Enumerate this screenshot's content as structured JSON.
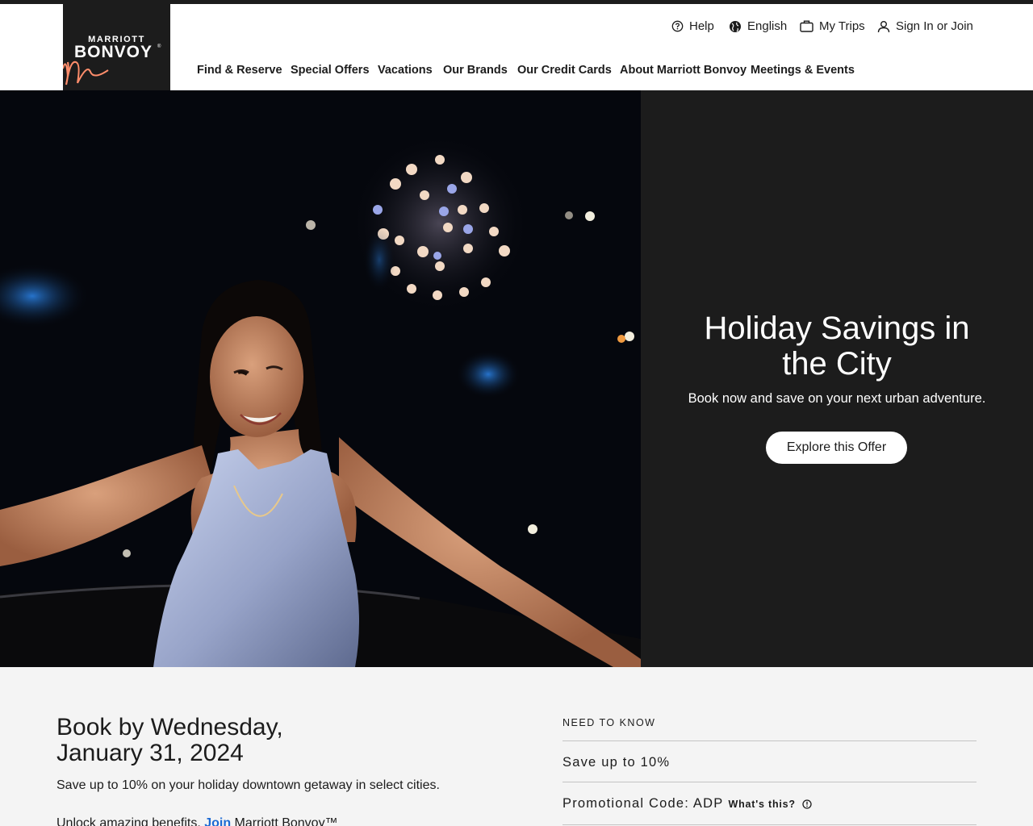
{
  "brand": {
    "logo_line1": "MARRIOTT",
    "logo_line2": "BONVOY",
    "logo_tm": "®",
    "logo_bg": "#1c1c1c",
    "accent": "#ff8d6b"
  },
  "utility_nav": {
    "help": {
      "label": "Help",
      "icon": "help-circle-icon"
    },
    "language": {
      "label": "English",
      "icon": "globe-icon"
    },
    "trips": {
      "label": "My Trips",
      "icon": "suitcase-icon"
    },
    "account": {
      "label": "Sign In or Join",
      "icon": "user-icon"
    }
  },
  "main_nav": [
    "Find & Reserve",
    "Special Offers",
    "Vacations",
    "Our Brands",
    "Our Credit Cards",
    "About Marriott Bonvoy",
    "Meetings & Events"
  ],
  "hero": {
    "title_line1": "Holiday Savings in",
    "title_line2": "the City",
    "subtitle": "Book now and save on your next urban adventure.",
    "cta": "Explore this Offer",
    "panel_bg": "#1c1c1c"
  },
  "offer": {
    "title_line1": "Book by Wednesday,",
    "title_line2": "January 31, 2024",
    "description": "Save up to 10% on your holiday downtown getaway in select cities.",
    "unlock_prefix": "Unlock amazing benefits. ",
    "join_link": "Join",
    "unlock_suffix": " Marriott Bonvoy™"
  },
  "need_to_know": {
    "heading": "NEED TO KNOW",
    "item1": "Save up to 10%",
    "item2": "Promotional Code: ADP",
    "whats_this": "What's this?",
    "link_color": "#1c6ad3"
  }
}
